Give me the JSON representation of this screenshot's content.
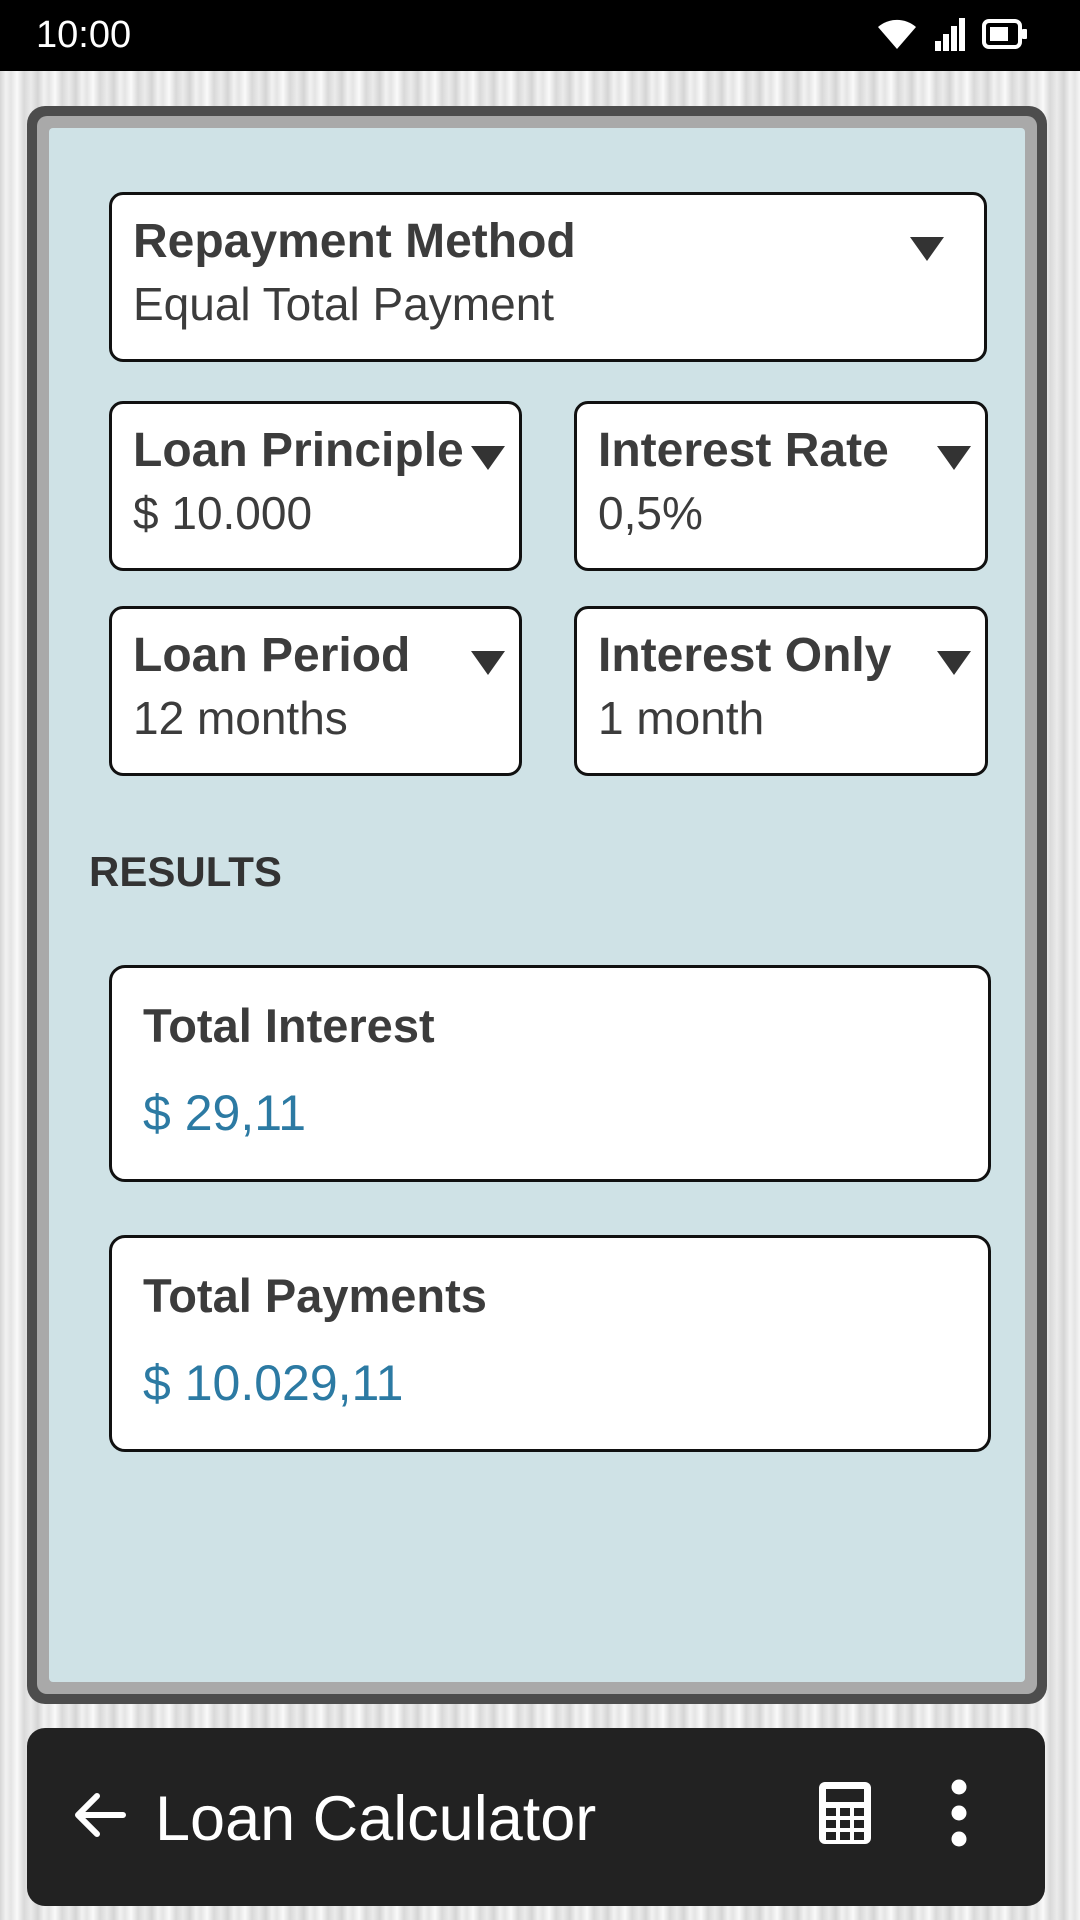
{
  "status_bar": {
    "time": "10:00",
    "icons": [
      "wifi-icon",
      "cellular-signal-icon",
      "battery-icon"
    ]
  },
  "inputs": {
    "repayment_method": {
      "label": "Repayment Method",
      "value": "Equal Total Payment"
    },
    "loan_principle": {
      "label": "Loan Principle",
      "value": "$ 10.000"
    },
    "interest_rate": {
      "label": "Interest Rate",
      "value": "0,5%"
    },
    "loan_period": {
      "label": "Loan Period",
      "value": "12 months"
    },
    "interest_only": {
      "label": "Interest Only",
      "value": "1 month"
    }
  },
  "results": {
    "heading": "RESULTS",
    "total_interest": {
      "label": "Total Interest",
      "value": "$ 29,11"
    },
    "total_payments": {
      "label": "Total Payments",
      "value": "$ 10.029,11"
    }
  },
  "app_bar": {
    "title": "Loan Calculator",
    "icons": [
      "back-arrow-icon",
      "calculator-icon",
      "more-vertical-icon"
    ]
  },
  "colors": {
    "panel_background": "#cfe2e6",
    "result_value": "#2c7aa3",
    "app_bar_background": "#222222",
    "frame_border": "#4d4d4d"
  }
}
